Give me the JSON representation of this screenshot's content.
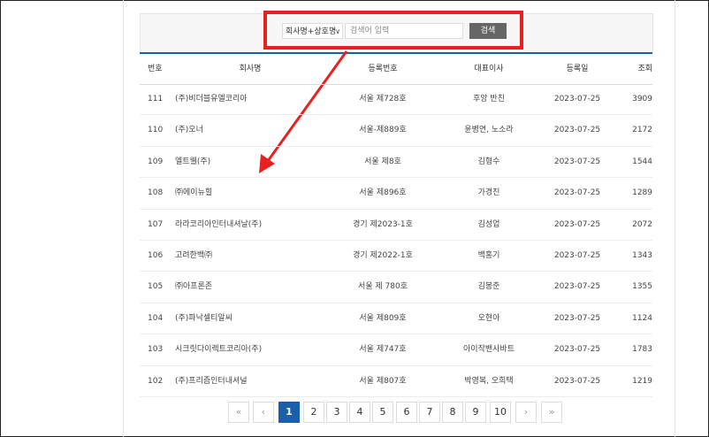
{
  "search": {
    "filter_selected": "회사명+상호명",
    "placeholder": "검색어 입력",
    "button_label": "검색"
  },
  "table": {
    "headers": [
      "번호",
      "회사명",
      "등록번호",
      "대표이사",
      "등록일",
      "조회"
    ],
    "rows": [
      [
        "111",
        "(주)비더블유엘코리아",
        "서울 제728호",
        "후앙 반친",
        "2023-07-25",
        "3909"
      ],
      [
        "110",
        "(주)오너",
        "서울-제889호",
        "윤병연, 노소라",
        "2023-07-25",
        "2172"
      ],
      [
        "109",
        "엘트웰(주)",
        "서울 제8호",
        "김형수",
        "2023-07-25",
        "1544"
      ],
      [
        "108",
        "㈜에이뉴힐",
        "서울 제896호",
        "가경진",
        "2023-07-25",
        "1289"
      ],
      [
        "107",
        "라라코리아인터내셔날(주)",
        "경기 제2023-1호",
        "김성업",
        "2023-07-25",
        "2072"
      ],
      [
        "106",
        "고려한백㈜",
        "경기 제2022-1호",
        "백홍기",
        "2023-07-25",
        "1343"
      ],
      [
        "105",
        "㈜아프론존",
        "서울 제 780호",
        "김봉준",
        "2023-07-25",
        "1355"
      ],
      [
        "104",
        "(주)파낙셀티알씨",
        "서울 제809호",
        "오현아",
        "2023-07-25",
        "1124"
      ],
      [
        "103",
        "시크릿다이렉트코리아(주)",
        "서울 제747호",
        "아이작밴사바트",
        "2023-07-25",
        "1783"
      ],
      [
        "102",
        "(주)프리즘인터내셔널",
        "서울 제807호",
        "박영복, 오희택",
        "2023-07-25",
        "1219"
      ]
    ]
  },
  "pagination": {
    "first": "«",
    "prev": "‹",
    "pages": [
      "1",
      "2",
      "3",
      "4",
      "5",
      "6",
      "7",
      "8",
      "9",
      "10"
    ],
    "current": "1",
    "next": "›",
    "last": "»"
  },
  "colors": {
    "annotation_red": "#e8201f",
    "accent_blue": "#1b5fa8",
    "search_button": "#666666"
  }
}
